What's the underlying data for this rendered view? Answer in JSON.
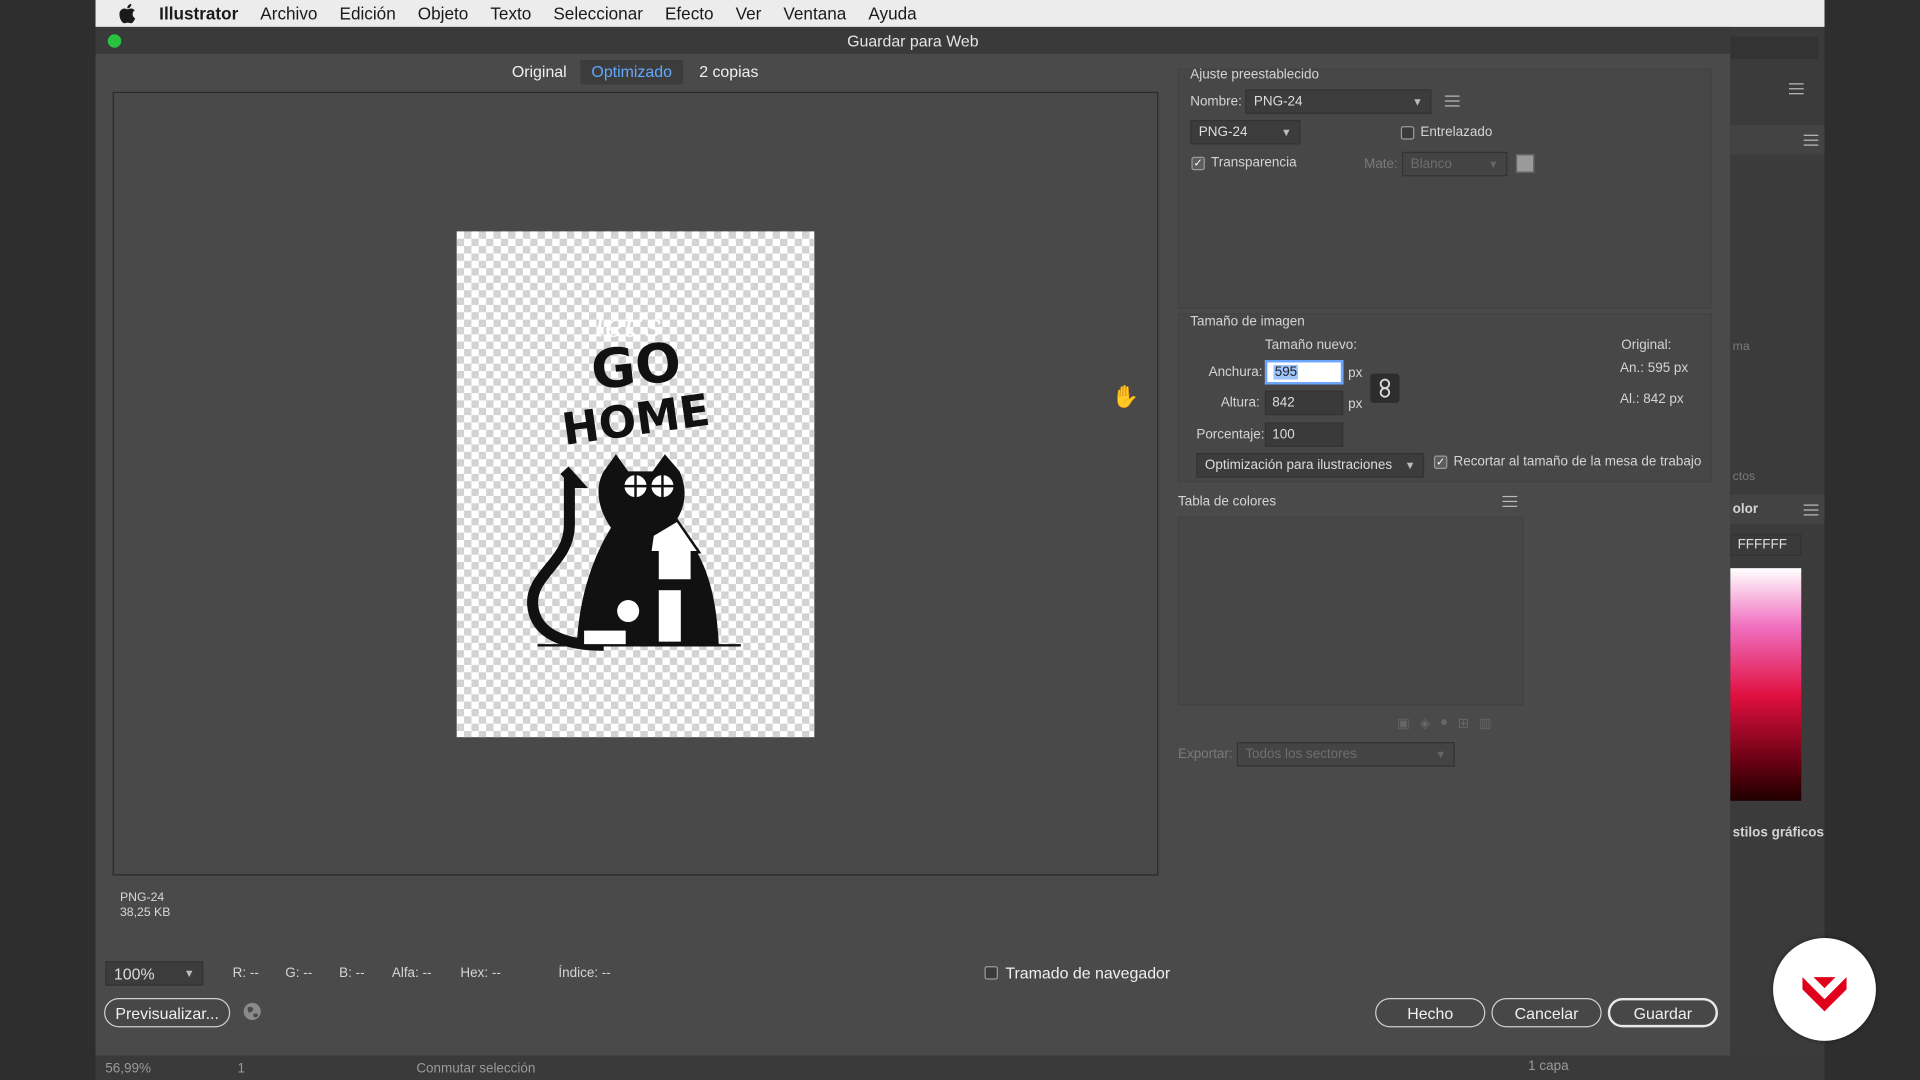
{
  "menubar": {
    "app": "Illustrator",
    "items": [
      "Archivo",
      "Edición",
      "Objeto",
      "Texto",
      "Seleccionar",
      "Efecto",
      "Ver",
      "Ventana",
      "Ayuda"
    ]
  },
  "dialog": {
    "title": "Guardar para Web",
    "tabs": [
      "Original",
      "Optimizado",
      "2 copias"
    ],
    "preview_info": {
      "format": "PNG-24",
      "size": "38,25 KB"
    },
    "artwork_text": {
      "top": "let's",
      "main1": "GO",
      "main2": "HOME"
    },
    "bottom": {
      "zoom": "100%",
      "r": "R: --",
      "g": "G: --",
      "b": "B: --",
      "alpha": "Alfa: --",
      "hex": "Hex: --",
      "index": "Índice: --",
      "browser_dither": "Tramado de navegador",
      "preview_btn": "Previsualizar...",
      "done": "Hecho",
      "cancel": "Cancelar",
      "save": "Guardar"
    },
    "preset": {
      "section": "Ajuste preestablecido",
      "name_label": "Nombre:",
      "name_value": "PNG-24",
      "format": "PNG-24",
      "interlaced": "Entrelazado",
      "transparency": "Transparencia",
      "matte_label": "Mate:",
      "matte_value": "Blanco"
    },
    "image_size": {
      "section": "Tamaño de imagen",
      "new_size": "Tamaño nuevo:",
      "width_label": "Anchura:",
      "width": "595",
      "height_label": "Altura:",
      "height": "842",
      "percent_label": "Porcentaje:",
      "percent": "100",
      "unit": "px",
      "original": "Original:",
      "orig_w": "An.:  595 px",
      "orig_h": "Al.:   842 px",
      "quality": "Optimización para ilustraciones",
      "clip": "Recortar al tamaño de la mesa de trabajo"
    },
    "color_table": {
      "section": "Tabla de colores"
    },
    "export": {
      "label": "Exportar:",
      "value": "Todos los sectores"
    }
  },
  "side": {
    "hex": "FFFFFF",
    "frag1": "olor",
    "frag2": "stilos gráficos",
    "frag3": "ma",
    "frag4": "ctos"
  },
  "status": {
    "zoom": "56,99%",
    "page": "1",
    "toggle": "Conmutar selección",
    "layers": "1 capa"
  },
  "colors": {
    "accent": "#62a8ff",
    "logo": "#e0001b"
  }
}
